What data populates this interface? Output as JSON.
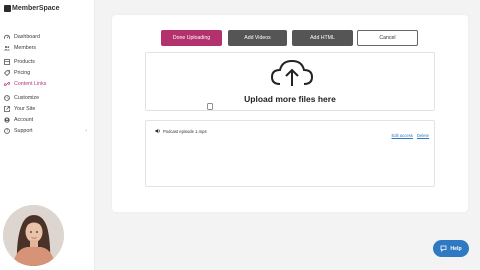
{
  "app": {
    "logo_text": "MemberSpace"
  },
  "sidebar": {
    "items": [
      {
        "label": "Dashboard",
        "icon": "dashboard-icon"
      },
      {
        "label": "Members",
        "icon": "members-icon"
      },
      {
        "label": "Products",
        "icon": "products-icon"
      },
      {
        "label": "Pricing",
        "icon": "pricing-icon"
      },
      {
        "label": "Content Links",
        "icon": "content-links-icon",
        "active": true
      },
      {
        "label": "Customize",
        "icon": "customize-icon"
      },
      {
        "label": "Your Site",
        "icon": "your-site-icon"
      },
      {
        "label": "Account",
        "icon": "account-icon"
      },
      {
        "label": "Support",
        "icon": "support-icon"
      }
    ],
    "support_chevron": "‹"
  },
  "toolbar": {
    "done_label": "Done Uploading",
    "add_videos_label": "Add Videos",
    "add_html_label": "Add HTML",
    "cancel_label": "Cancel"
  },
  "dropzone": {
    "title": "Upload more files here",
    "icon": "cloud-upload-icon"
  },
  "files": [
    {
      "name": "Podcast episode 1.mp4",
      "icon": "speaker-icon",
      "actions": [
        "Edit access",
        "Delete"
      ]
    }
  ],
  "help": {
    "label": "Help",
    "icon": "help-chat-icon"
  },
  "colors": {
    "accent": "#b3326e",
    "dark_button": "#555555",
    "link": "#2f79c2",
    "active_nav": "#b03a7b"
  }
}
